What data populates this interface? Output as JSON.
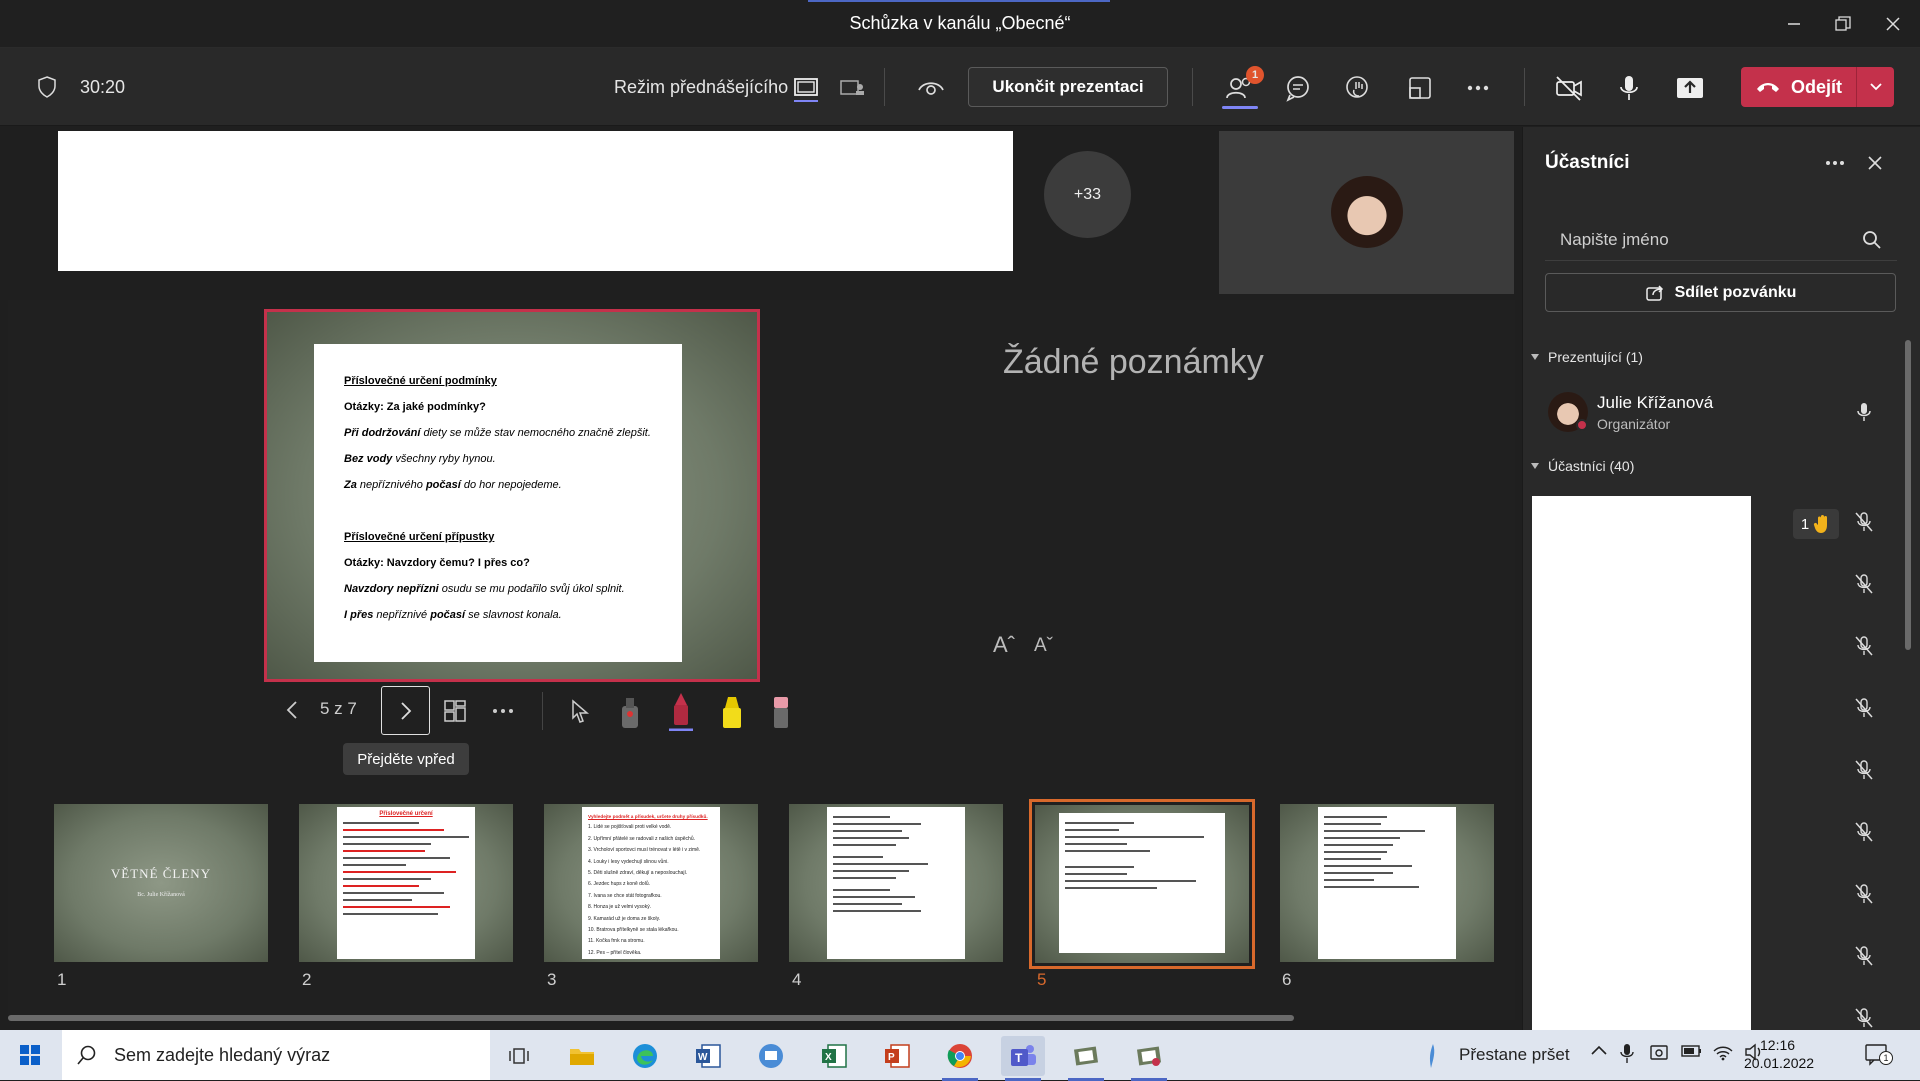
{
  "window": {
    "title": "Schůzka v kanálu „Obecné“"
  },
  "toolbar": {
    "timer": "30:20",
    "presenter_mode_label": "Režim přednášejícího",
    "stop_presenting_label": "Ukončit prezentaci",
    "participants_badge": "1",
    "leave_label": "Odejít"
  },
  "stage": {
    "overflow_count": "+33",
    "notes_empty": "Žádné poznámky",
    "font_increase": "Aˆ",
    "font_decrease": "Aˇ"
  },
  "slide": {
    "lines": [
      {
        "text": "Příslovečné určení podmínky",
        "style": "u"
      },
      {
        "text": "Otázky: Za jaké podmínky?",
        "style": "b"
      },
      {
        "parts": [
          {
            "t": "Při dodržování",
            "s": "bi"
          },
          {
            "t": " diety se může stav nemocného značně zlepšit.",
            "s": "i"
          }
        ]
      },
      {
        "parts": [
          {
            "t": "Bez vody",
            "s": "bi"
          },
          {
            "t": " všechny ryby hynou.",
            "s": "i"
          }
        ]
      },
      {
        "parts": [
          {
            "t": "Za",
            "s": "bi"
          },
          {
            "t": " nepříznivého ",
            "s": "i"
          },
          {
            "t": "počasí",
            "s": "bi"
          },
          {
            "t": " do hor nepojedeme.",
            "s": "i"
          }
        ]
      },
      {
        "gap": true
      },
      {
        "text": "Příslovečné určení přípustky",
        "style": "u"
      },
      {
        "text": "Otázky:  Navzdory čemu? I přes co?",
        "style": "b"
      },
      {
        "parts": [
          {
            "t": "Navzdory nepřízni",
            "s": "bi"
          },
          {
            "t": " osudu se mu podařilo svůj úkol splnit.",
            "s": "i"
          }
        ]
      },
      {
        "parts": [
          {
            "t": "I přes",
            "s": "bi"
          },
          {
            "t": " nepříznivé ",
            "s": "i"
          },
          {
            "t": "počasí",
            "s": "bi"
          },
          {
            "t": " se slavnost konala.",
            "s": "i"
          }
        ]
      }
    ]
  },
  "slide_nav": {
    "counter": "5 z 7",
    "tooltip": "Přejděte vpřed"
  },
  "thumbnails": [
    {
      "num": "1",
      "title": "VĚTNÉ ČLENY",
      "subtitle": "Bc. Julie Křížanová"
    },
    {
      "num": "2",
      "title": "Příslovečné určení"
    },
    {
      "num": "3",
      "title": "Vyhledejte podmět a přísudek, určete druhy přísudků.",
      "items": [
        "1. Lidé se pojišťovali proti velké vodě.",
        "2. Upřímní přátelé se radovali z našich úspěchů.",
        "3. Vrcholoví sportovci musí trénovat v létě i v zimě.",
        "4. Louky i lesy vydechují slinou vůni.",
        "5. Děti slušně zdraví, děkují a neposlouchají.",
        "6. Jezdec hups z koně dolů.",
        "7. Ivana se chce stát fotografkou.",
        "8. Honza je už velmi vysoký.",
        "9. Kamarád už je doma ze školy.",
        "10. Bratrova přítelkyně se stala lékařkou.",
        "11. Kočka frnk na stromu.",
        "12. Pes – přítel člověka."
      ]
    },
    {
      "num": "4"
    },
    {
      "num": "5"
    },
    {
      "num": "6"
    }
  ],
  "panel": {
    "title": "Účastníci",
    "search_placeholder": "Napište jméno",
    "share_invite_label": "Sdílet pozvánku",
    "presenters_header": "Prezentující (1)",
    "presenter_name": "Julie Křížanová",
    "presenter_role": "Organizátor",
    "participants_header": "Účastníci (40)",
    "raised_hands": "1"
  },
  "taskbar": {
    "search_placeholder": "Sem zadejte hledaný výraz",
    "weather": "Přestane pršet",
    "time": "12:16",
    "date": "20.01.2022",
    "notification_count": "1"
  },
  "colors": {
    "accent": "#4c67c4",
    "leave_red": "#c4314b",
    "selected_thumb": "#d8692c"
  }
}
